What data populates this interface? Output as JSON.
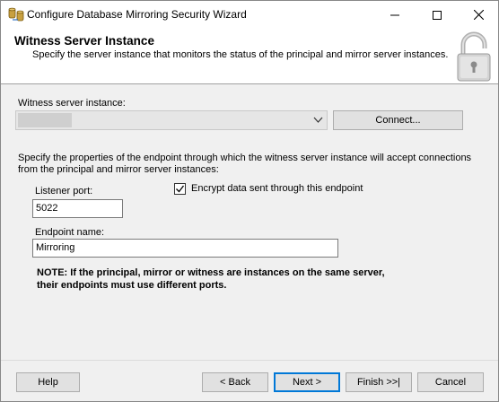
{
  "window": {
    "title": "Configure Database Mirroring Security Wizard"
  },
  "header": {
    "title": "Witness Server Instance",
    "subtitle": "Specify the server instance that monitors the status of the principal and mirror server instances."
  },
  "witness": {
    "label": "Witness server instance:",
    "selected_value": "",
    "connect_label": "Connect..."
  },
  "endpoint": {
    "description": "Specify the properties of the endpoint through which the witness server instance will accept connections from the principal and mirror server instances:",
    "listener_port_label": "Listener port:",
    "listener_port_value": "5022",
    "encrypt_label": "Encrypt data sent through this endpoint",
    "encrypt_checked": true,
    "endpoint_name_label": "Endpoint name:",
    "endpoint_name_value": "Mirroring",
    "note_line1": "NOTE: If the principal, mirror or witness are instances on the same server,",
    "note_line2": "their endpoints must use different ports."
  },
  "footer": {
    "help_label": "Help",
    "back_label": "< Back",
    "next_label": "Next >",
    "finish_label": "Finish >>|",
    "cancel_label": "Cancel"
  },
  "icons": {
    "app": "database-mirroring-icon",
    "header": "padlock-icon",
    "combo": "chevron-down-icon",
    "checkbox": "checkmark-icon"
  },
  "colors": {
    "accent": "#0078d7",
    "window_bg": "#f0f0f0"
  }
}
